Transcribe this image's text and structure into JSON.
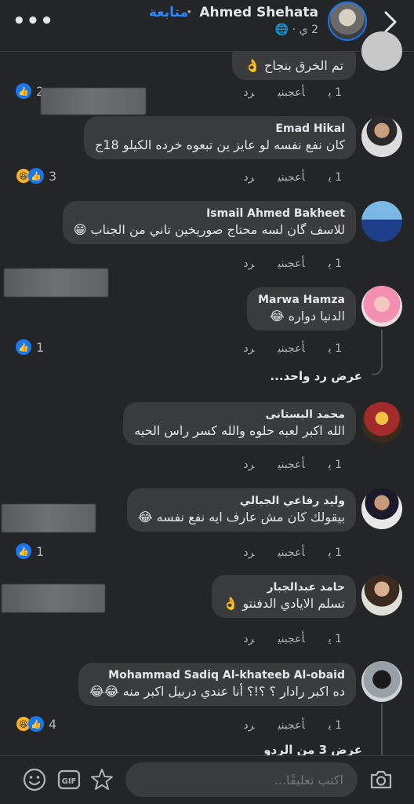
{
  "header": {
    "name": "Ahmed Shehata",
    "follow": "متابعة",
    "separator": "·",
    "meta": "2 ي · "
  },
  "comments": [
    {
      "text": "تم الخرق بنجاح 👌",
      "time": "1 ي",
      "like": "أعجبني",
      "reply": "رد",
      "reaction_count": "2"
    },
    {
      "name": "Emad Hikal",
      "text": "كان نفع نفسه لو عايز ين تبعوه خرده الكيلو 18ج",
      "time": "1 ي",
      "like": "أعجبني",
      "reply": "رد",
      "reaction_count": "3"
    },
    {
      "name": "Ismail Ahmed Bakheet",
      "text": "للاسف گان لسه محتاج صوريخين تاني من الجناب 😁",
      "time": "1 ي",
      "like": "أعجبني",
      "reply": "رد"
    },
    {
      "name": "Marwa Hamza",
      "text": "الدنيا دواره 😂",
      "time": "1 ي",
      "like": "أعجبني",
      "reply": "رد",
      "reaction_count": "1",
      "view_replies": "عرض رد واحد..."
    },
    {
      "name": "محمد البستانى",
      "text": "الله اكبر لعبه حلوه والله كسر راس الحيه",
      "time": "1 ي",
      "like": "أعجبني",
      "reply": "رد"
    },
    {
      "name": "وليد رفاعي الجبالي",
      "text": "بيقولك كان مش عارف ايه نفع نفسه 😂",
      "time": "1 ي",
      "like": "أعجبني",
      "reply": "رد",
      "reaction_count": "1"
    },
    {
      "name": "حامد عبدالجبار",
      "text": "تسلم الايادي الدفنتو 👌",
      "time": "1 ي",
      "like": "أعجبني",
      "reply": "رد"
    },
    {
      "name": "Mohammad Sadiq Al-khateeb Al-obaid",
      "text": "ده اكبر رادار ؟ ؟!؟ أنا عندي دربيل اكبر منه 😂😂",
      "time": "1 ي",
      "like": "أعجبني",
      "reply": "رد",
      "reaction_count": "4",
      "view_replies": "عرض 3 من الردو"
    }
  ],
  "composer": {
    "placeholder": "اكتب تعليقًا..."
  },
  "icons": {
    "menu": "more-dots-icon",
    "back": "chevron-right-icon",
    "globe": "globe-icon",
    "like_reaction": "like-reaction-icon",
    "haha_reaction": "haha-reaction-icon",
    "emoji": "emoji-icon",
    "gif": "gif-icon",
    "sticker": "sticker-icon",
    "camera": "camera-icon"
  },
  "colors": {
    "background": "#242526",
    "bubble": "#3a3b3c",
    "accent": "#2d88ff",
    "like": "#1877f2",
    "haha": "#f7b125"
  }
}
